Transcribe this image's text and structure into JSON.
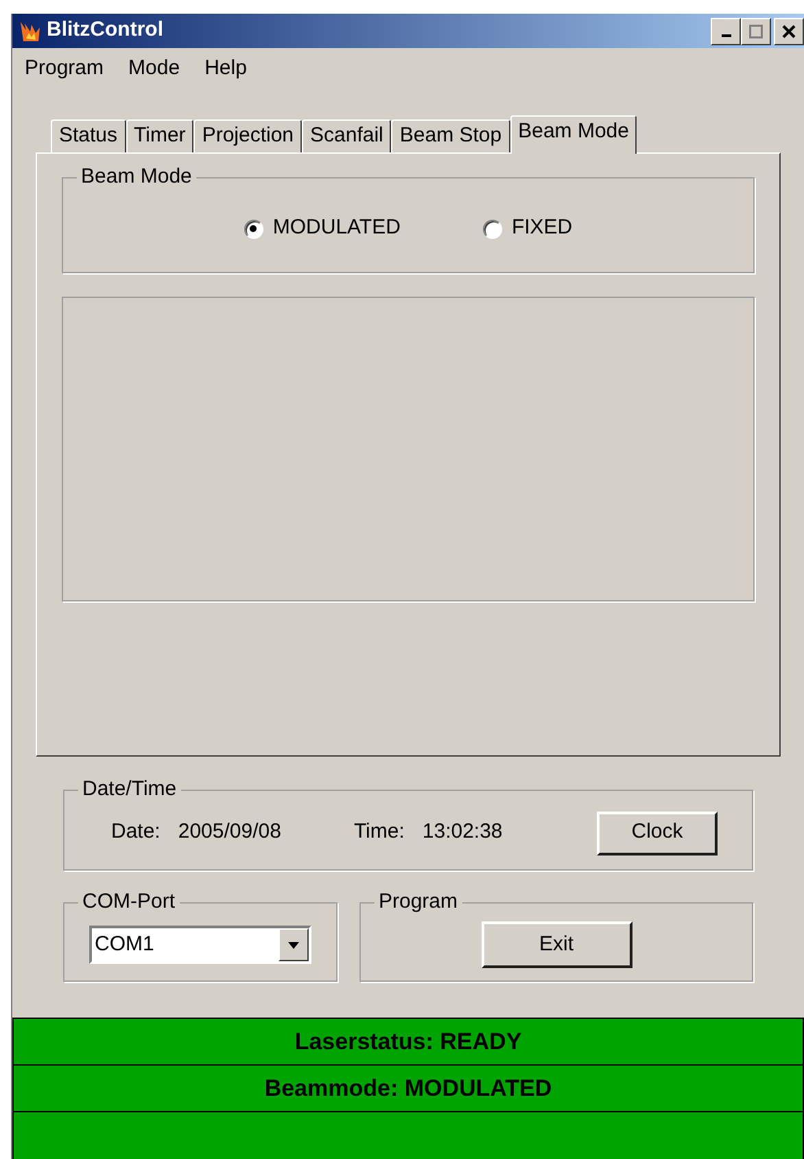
{
  "window": {
    "title": "BlitzControl"
  },
  "menu": [
    "Program",
    "Mode",
    "Help"
  ],
  "tabs": [
    {
      "label": "Status",
      "selected": false
    },
    {
      "label": "Timer",
      "selected": false
    },
    {
      "label": "Projection",
      "selected": false
    },
    {
      "label": "Scanfail",
      "selected": false
    },
    {
      "label": "Beam Stop",
      "selected": false
    },
    {
      "label": "Beam Mode",
      "selected": true
    }
  ],
  "beam_mode": {
    "title": "Beam Mode",
    "options": [
      {
        "label": "MODULATED",
        "selected": true
      },
      {
        "label": "FIXED",
        "selected": false
      }
    ]
  },
  "date_time": {
    "title": "Date/Time",
    "date_label": "Date:",
    "date": "2005/09/08",
    "time_label": "Time:",
    "time": "13:02:38",
    "button": "Clock"
  },
  "com_port": {
    "title": "COM-Port",
    "value": "COM1"
  },
  "program": {
    "title": "Program",
    "button": "Exit"
  },
  "status_bars": [
    "Laserstatus: READY",
    "Beammode: MODULATED"
  ]
}
